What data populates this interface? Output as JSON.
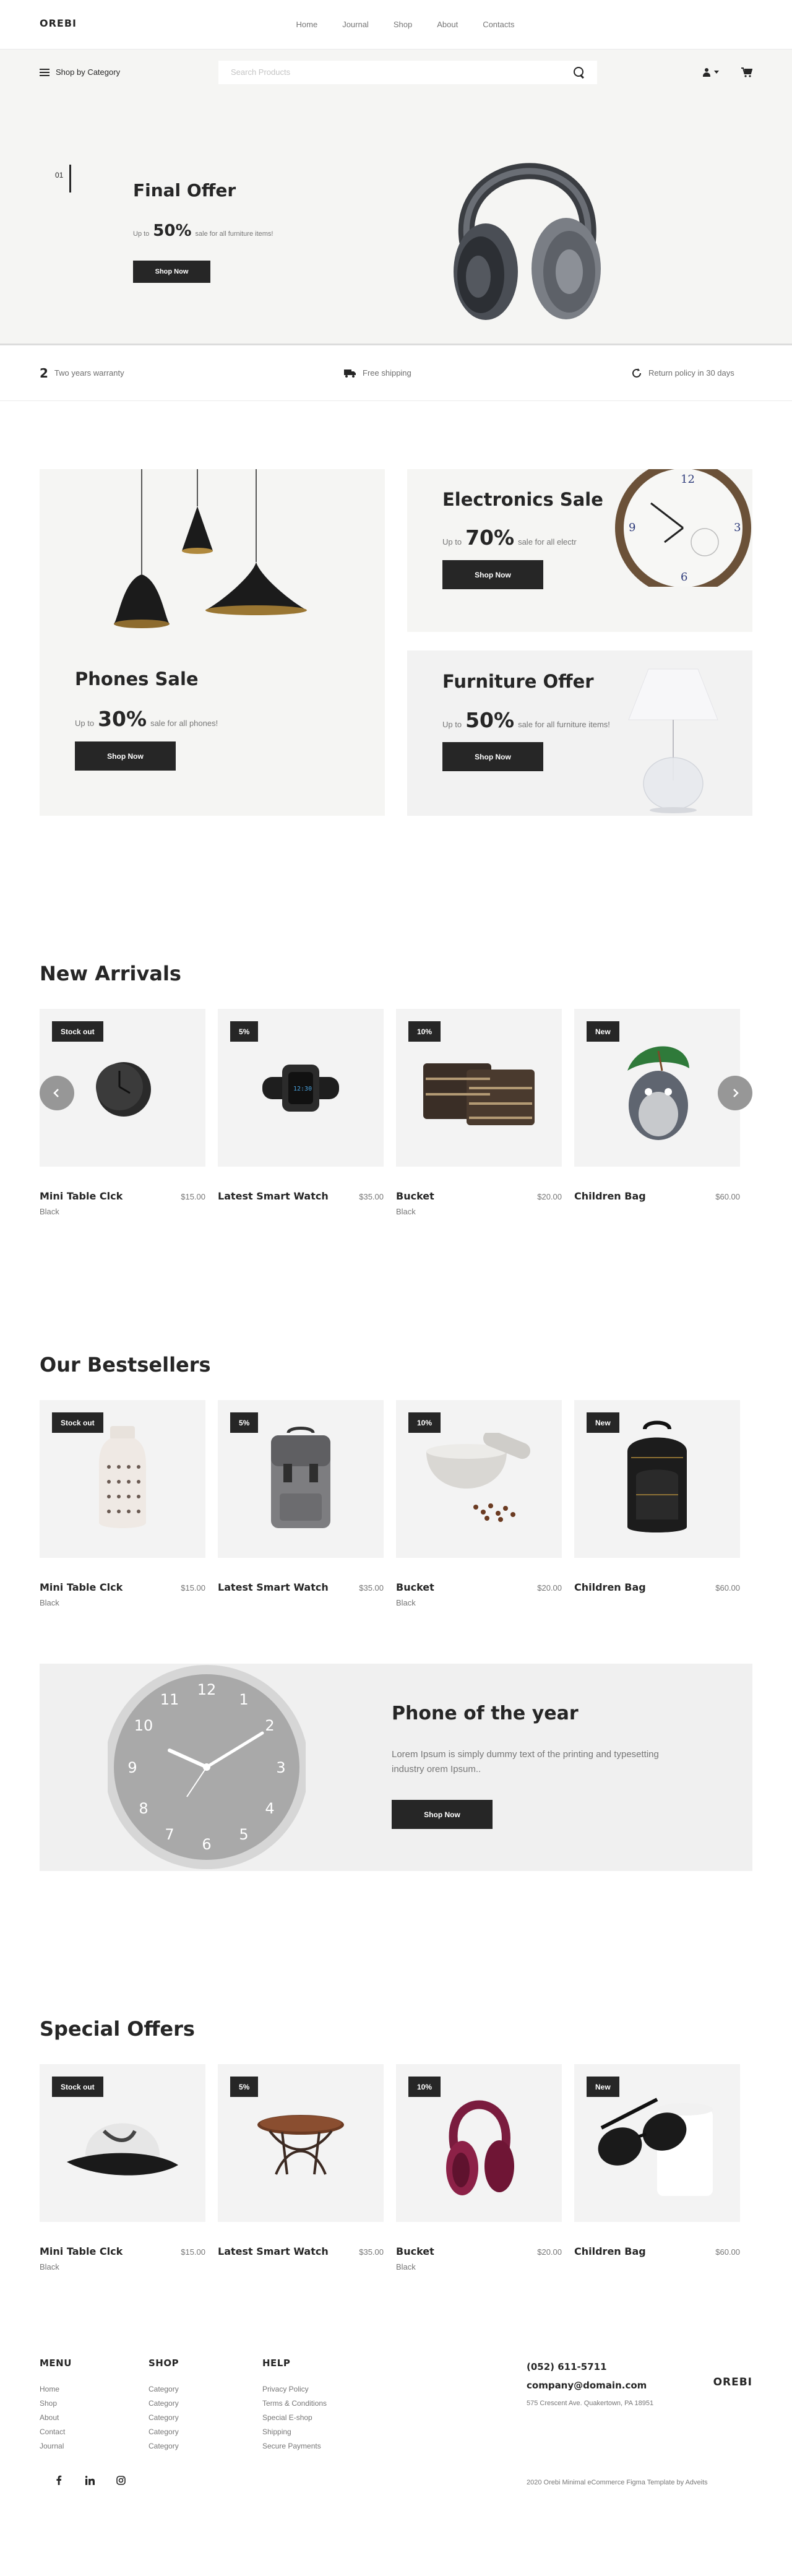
{
  "header": {
    "logo": "OREBI",
    "nav": [
      "Home",
      "Journal",
      "Shop",
      "About",
      "Contacts"
    ]
  },
  "category_bar": {
    "label": "Shop by Category",
    "search_placeholder": "Search Products"
  },
  "hero": {
    "index": "01",
    "title": "Final Offer",
    "sub_prefix": "Up to",
    "sub_pct": "50%",
    "sub_suffix": "sale for all furniture items!",
    "button": "Shop Now",
    "bg_color": "#f5f5f3"
  },
  "features": [
    {
      "icon": "number-2",
      "num": "2",
      "label": "Two years warranty"
    },
    {
      "icon": "truck-icon",
      "label": "Free shipping"
    },
    {
      "icon": "return-icon",
      "label": "Return policy in 30 days"
    }
  ],
  "promos": {
    "phones": {
      "title": "Phones Sale",
      "prefix": "Up to",
      "pct": "30%",
      "suffix": "sale for all phones!",
      "button": "Shop Now"
    },
    "electronics": {
      "title": "Electronics Sale",
      "prefix": "Up to",
      "pct": "70%",
      "suffix": "sale for all electr",
      "button": "Shop Now"
    },
    "furniture": {
      "title": "Furniture Offer",
      "prefix": "Up to",
      "pct": "50%",
      "suffix": "sale for all furniture items!",
      "button": "Shop Now"
    }
  },
  "new_arrivals": {
    "title": "New Arrivals",
    "products": [
      {
        "badge": "Stock out",
        "name": "Mini Table Clck",
        "price": "$15.00",
        "color": "Black",
        "icon": "table-clock"
      },
      {
        "badge": "5%",
        "name": "Latest Smart Watch",
        "price": "$35.00",
        "color": "",
        "icon": "smart-watch"
      },
      {
        "badge": "10%",
        "name": "Bucket",
        "price": "$20.00",
        "color": "Black",
        "icon": "basket"
      },
      {
        "badge": "New",
        "name": "Children Bag",
        "price": "$60.00",
        "color": "",
        "icon": "plush-toy"
      }
    ]
  },
  "bestsellers": {
    "title": "Our Bestsellers",
    "products": [
      {
        "badge": "Stock out",
        "name": "Mini Table Clck",
        "price": "$15.00",
        "color": "Black",
        "icon": "vase"
      },
      {
        "badge": "5%",
        "name": "Latest Smart Watch",
        "price": "$35.00",
        "color": "",
        "icon": "backpack-grey"
      },
      {
        "badge": "10%",
        "name": "Bucket",
        "price": "$20.00",
        "color": "Black",
        "icon": "mortar"
      },
      {
        "badge": "New",
        "name": "Children Bag",
        "price": "$60.00",
        "color": "",
        "icon": "backpack-black"
      }
    ]
  },
  "banner": {
    "title": "Phone of the year",
    "text": "Lorem Ipsum is simply dummy text of the printing and typesetting industry orem Ipsum..",
    "button": "Shop Now"
  },
  "special_offers": {
    "title": "Special Offers",
    "products": [
      {
        "badge": "Stock out",
        "name": "Mini Table Clck",
        "price": "$15.00",
        "color": "Black",
        "icon": "cap"
      },
      {
        "badge": "5%",
        "name": "Latest Smart Watch",
        "price": "$35.00",
        "color": "",
        "icon": "side-table"
      },
      {
        "badge": "10%",
        "name": "Bucket",
        "price": "$20.00",
        "color": "Black",
        "icon": "headphones-red"
      },
      {
        "badge": "New",
        "name": "Children Bag",
        "price": "$60.00",
        "color": "",
        "icon": "sunglasses"
      }
    ]
  },
  "footer": {
    "menu": {
      "title": "MENU",
      "links": [
        "Home",
        "Shop",
        "About",
        "Contact",
        "Journal"
      ]
    },
    "shop": {
      "title": "SHOP",
      "links": [
        "Category",
        "Category",
        "Category",
        "Category",
        "Category"
      ]
    },
    "help": {
      "title": "HELP",
      "links": [
        "Privacy Policy",
        "Terms & Conditions",
        "Special E-shop",
        "Shipping",
        "Secure Payments"
      ]
    },
    "phone": "(052) 611-5711",
    "email": "company@domain.com",
    "address": "575 Crescent Ave. Quakertown, PA 18951",
    "logo": "OREBI",
    "socials": [
      "facebook-icon",
      "linkedin-icon",
      "instagram-icon"
    ],
    "copyright": "2020 Orebi Minimal eCommerce Figma Template by Adveits"
  }
}
